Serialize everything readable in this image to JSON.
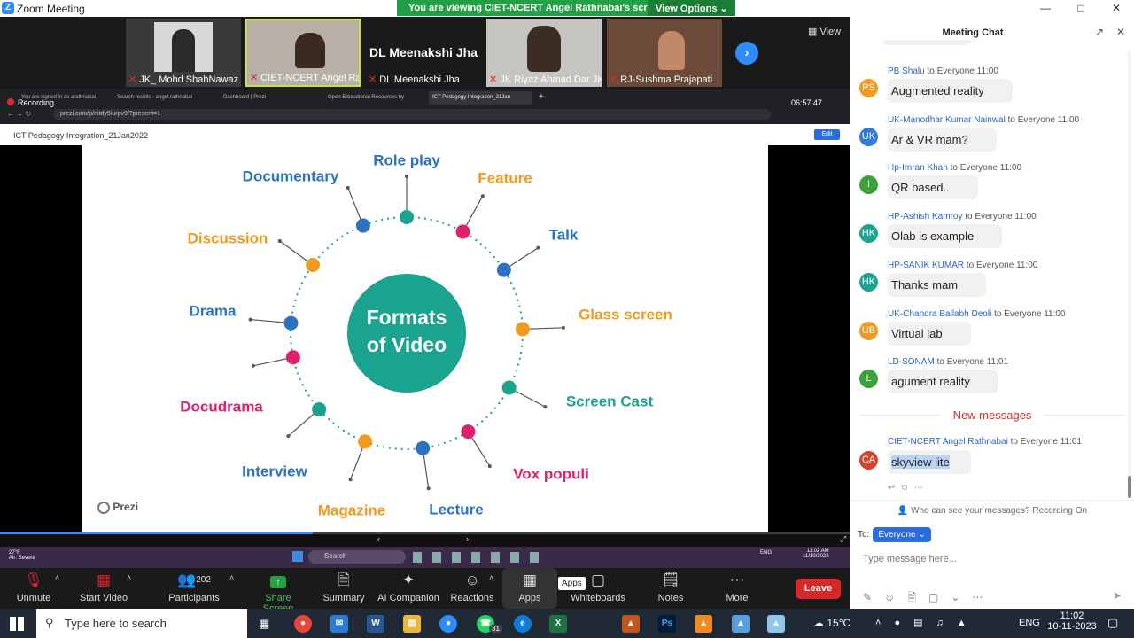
{
  "window": {
    "title": "Zoom Meeting",
    "logo": "Z",
    "banner_text": "You are viewing CIET-NCERT Angel Rathnabai's screen",
    "view_options": "View Options"
  },
  "participants": {
    "view_label": "View",
    "tiles": [
      {
        "name": "JK_ Mohd ShahNawaz ..."
      },
      {
        "name": "CIET-NCERT Angel Rathna..."
      },
      {
        "name": "DL Meenakshi Jha",
        "big": "DL Meenakshi Jha"
      },
      {
        "name": "JK Riyaz Ahmad Dar JK..."
      },
      {
        "name": "RJ-Sushma Prajapati"
      }
    ]
  },
  "browser": {
    "tabs": [
      "You are signed in as arathnabai",
      "Search results - angel.rathnabai",
      "Dashboard | Prezi",
      "Open Educational Resources by",
      "ICT Pedagogy Integration_21Jan"
    ],
    "recording": "Recording",
    "url": "prezi.com/p/nitdy5iurpv9/?present=1",
    "clock": "06:57:47"
  },
  "prezi": {
    "title": "ICT Pedagogy Integration_21Jan2022",
    "edit": "Edit",
    "logo": "Prezi",
    "center_line1": "Formats",
    "center_line2": "of Video",
    "progress_fraction": 0.368,
    "labels": [
      "Role play",
      "Feature",
      "Talk",
      "Glass screen",
      "Screen Cast",
      "Vox populi",
      "Lecture",
      "Magazine",
      "Interview",
      "Docudrama",
      "Drama",
      "Discussion",
      "Documentary"
    ]
  },
  "inner_taskbar": {
    "search": "Search",
    "time": "11:02 AM",
    "date": "11/10/2023",
    "weather": "27°F",
    "weather_desc": "Air: Severe",
    "lang": "ENG"
  },
  "toolbar": {
    "unmute": "Unmute",
    "start_video": "Start Video",
    "participants": "Participants",
    "participants_count": "202",
    "share_screen": "Share Screen",
    "summary": "Summary",
    "ai_companion": "AI Companion",
    "reactions": "Reactions",
    "apps": "Apps",
    "apps_tooltip": "Apps",
    "whiteboards": "Whiteboards",
    "notes": "Notes",
    "more": "More",
    "leave": "Leave"
  },
  "chat": {
    "header": "Meeting Chat",
    "to_everyone": "to Everyone",
    "messages": [
      {
        "initials": "PS",
        "color": "#f29a1f",
        "sender": "PB Shalu",
        "time": "11:00",
        "text": "Augmented reality"
      },
      {
        "initials": "UK",
        "color": "#2f7bd8",
        "sender": "UK-Manodhar Kumar Nainwal",
        "time": "11:00",
        "text": "Ar & VR mam?"
      },
      {
        "initials": "I",
        "color": "#3ba23b",
        "sender": "Hp-Imran Khan",
        "time": "11:00",
        "text": "QR based.."
      },
      {
        "initials": "HK",
        "color": "#1aa38f",
        "sender": "HP-Ashish Kamroy",
        "time": "11:00",
        "text": "Olab is example"
      },
      {
        "initials": "HK",
        "color": "#1aa38f",
        "sender": "HP-SANIK KUMAR",
        "time": "11:00",
        "text": "Thanks mam"
      },
      {
        "initials": "UB",
        "color": "#f29a1f",
        "sender": "UK-Chandra Ballabh Deoli",
        "time": "11:00",
        "text": "Virtual lab"
      },
      {
        "initials": "L",
        "color": "#3ba23b",
        "sender": "LD-SONAM",
        "time": "11:01",
        "text": "agument reality"
      }
    ],
    "new_messages": "New messages",
    "latest": {
      "initials": "CA",
      "color": "#d9412f",
      "sender": "CIET-NCERT Angel Rathnabai",
      "time": "11:01",
      "text": "skyview lite"
    },
    "who_can_see": "Who can see your messages? Recording On",
    "to_label": "To:",
    "to_value": "Everyone",
    "placeholder": "Type message here..."
  },
  "taskbar": {
    "search": "Type here to search",
    "weather": "15°C",
    "lang": "ENG",
    "time": "11:02",
    "date": "10-11-2023",
    "badge": "31"
  }
}
